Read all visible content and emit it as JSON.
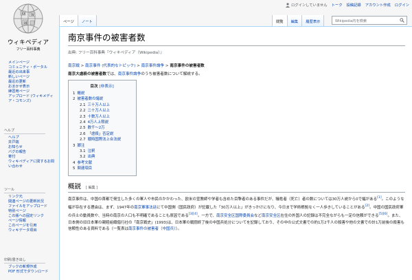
{
  "site": {
    "wordmark": "ウィキペディア",
    "tagline": "フリー百科事典"
  },
  "personal": {
    "anon": "ログインしていません",
    "talk": "トーク",
    "contribs": "投稿記録",
    "create": "アカウント作成",
    "login": "ログイン"
  },
  "tabs": {
    "page": "ページ",
    "talk": "ノート",
    "read": "閲覧",
    "edit": "編集",
    "history": "履歴表示"
  },
  "search": {
    "placeholder": "Wikipedia内を検索"
  },
  "sidebar": {
    "main": [
      "メインページ",
      "コミュニティ・ポータル",
      "最近の出来事",
      "新しいページ",
      "最近の更新",
      "おまかせ表示",
      "練習用ページ",
      "アップロード (ウィキメディア・コモンズ)"
    ],
    "help_heading": "ヘルプ",
    "help": [
      "ヘルプ",
      "井戸端",
      "お知らせ",
      "バグの報告",
      "寄付",
      "ウィキペディアに関するお問い合わせ"
    ],
    "tools_heading": "ツール",
    "tools": [
      "リンク元",
      "関連ページの更新状況",
      "ファイルをアップロード",
      "特別ページ",
      "この版への固定リンク",
      "ページ情報",
      "このページを引用",
      "ウィキデータ項目"
    ],
    "print_heading": "印刷/書き出し",
    "print": [
      "ブックの新規作成",
      "PDF 形式でダウンロード"
    ]
  },
  "article": {
    "title": "南京事件の被害者数",
    "site_sub": "出典: フリー百科事典『ウィキペディア（Wikipedia）』",
    "breadcrumb": {
      "a": "南京戦",
      "b": "南京事件 (代表的なトピック)",
      "c": "南京事件論争",
      "current": "南京事件の被害者数",
      "sep": " > "
    },
    "lead": {
      "bold": "南京大虐殺の被害者数",
      "mid": "では、",
      "link": "南京事件論争",
      "rest": "のうち被害者数について解説する。"
    }
  },
  "toc": {
    "title": "目次",
    "toggle": "[非表示]",
    "items": [
      {
        "num": "1",
        "label": "概説",
        "sub": false
      },
      {
        "num": "2",
        "label": "被害者数の諸説",
        "sub": false
      },
      {
        "num": "2.1",
        "label": "三十万人以上",
        "sub": true
      },
      {
        "num": "2.2",
        "label": "二十万人以上",
        "sub": true
      },
      {
        "num": "2.3",
        "label": "十数万人以上",
        "sub": true
      },
      {
        "num": "2.4",
        "label": "4万人上限説",
        "sub": true
      },
      {
        "num": "2.5",
        "label": "数千〜2万",
        "sub": true
      },
      {
        "num": "2.6",
        "label": "「虐殺」否定説",
        "sub": true
      },
      {
        "num": "2.7",
        "label": "戦時国際法上合法説",
        "sub": true
      },
      {
        "num": "3",
        "label": "脚注",
        "sub": false
      },
      {
        "num": "3.1",
        "label": "注釈",
        "sub": true
      },
      {
        "num": "3.2",
        "label": "出典",
        "sub": true
      },
      {
        "num": "4",
        "label": "参考文献",
        "sub": false
      },
      {
        "num": "5",
        "label": "関連項目",
        "sub": false
      }
    ]
  },
  "section": {
    "heading": "概説",
    "edit": "[ 編集 ]",
    "para": "南京事件は、中国の首都で発生した多くの軍人や市民のかかわった、欧米の宣教師や学者も含めた目撃者のある事件だが、犠牲者（死亡）者の数については30万人説から0で幅がある",
    "r1": "[1]",
    "para2": "。このような幅が存在する理由は、まず、1947年の",
    "l1": "南京軍事法廷",
    "para3": "にて中国側（国民政府）が記載した「30万人以上」がきっかけになり、今日まで学術根拠なく一人歩きしていることがある",
    "r2": "[2]",
    "para4": "。中国の国民政府軍の兵士の動員数や、当時の南京の人口も不明確であることも原因である",
    "r3": "[3][4]",
    "para5": "。一方で、",
    "l2": "南京安全区国際委員会",
    "para6": "など",
    "l3": "南京安全区",
    "para7": "在住の外国人の記録は不完全ながらも一定の信頼ができる",
    "r4": "[5][6]",
    "para8": "。また、日本側の旧日本軍の親睦組織偕行社の「南京戦史」(1993)は、日本軍の戦闘終了後の中国兵処分についてを記録しており、その中の公式文書での約1万2千人の殺害や他の文書での計1万前後の殺害も信頼性のある資料である（一覧表は",
    "l4": "南京事件の被害者（中国兵）",
    "para9": "）。"
  },
  "colors": {
    "link": "#0645ad",
    "border": "#a7d7f9",
    "sidebar_bg": "#f6f6f6"
  }
}
